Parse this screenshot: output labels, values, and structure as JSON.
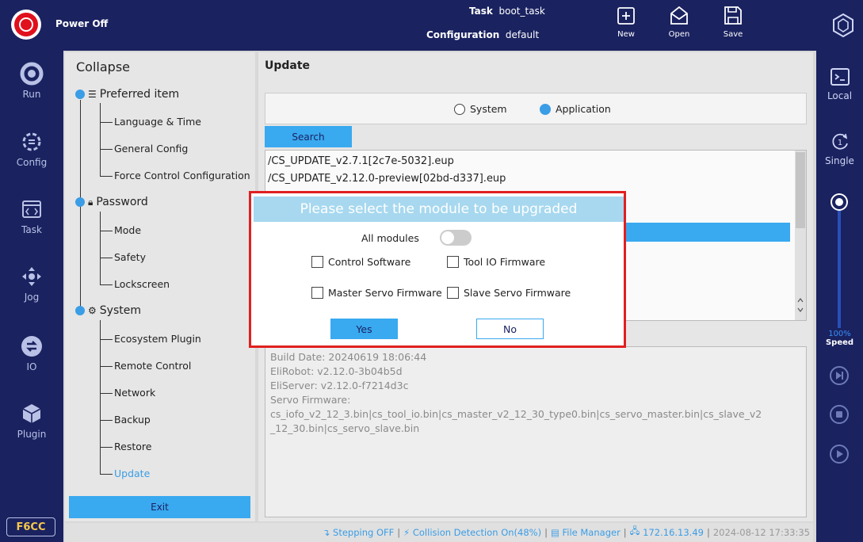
{
  "topbar": {
    "status": "Power Off",
    "task_label": "Task",
    "task_value": "boot_task",
    "config_label": "Configuration",
    "config_value": "default",
    "new_label": "New",
    "open_label": "Open",
    "save_label": "Save"
  },
  "leftnav": {
    "items": [
      {
        "label": "Run",
        "icon": "run-icon"
      },
      {
        "label": "Config",
        "icon": "config-icon"
      },
      {
        "label": "Task",
        "icon": "task-icon"
      },
      {
        "label": "Jog",
        "icon": "jog-icon"
      },
      {
        "label": "IO",
        "icon": "io-icon"
      },
      {
        "label": "Plugin",
        "icon": "plugin-icon"
      }
    ],
    "badge": "F6CC"
  },
  "rightnav": {
    "local_label": "Local",
    "single_label": "Single",
    "single_num": "1",
    "speed_pct": "100%",
    "speed_label": "Speed",
    "speed_value": 1.0
  },
  "settings": {
    "title": "Collapse",
    "groups": [
      {
        "label": "Preferred item",
        "icon": "list-icon",
        "items": [
          "Language & Time",
          "General Config",
          "Force Control Configuration"
        ]
      },
      {
        "label": "Password",
        "icon": "lock-icon",
        "items": [
          "Mode",
          "Safety",
          "Lockscreen"
        ]
      },
      {
        "label": "System",
        "icon": "gear-icon",
        "items": [
          "Ecosystem Plugin",
          "Remote Control",
          "Network",
          "Backup",
          "Restore",
          "Update"
        ]
      }
    ],
    "exit_label": "Exit"
  },
  "update": {
    "title": "Update",
    "radio_system": "System",
    "radio_application": "Application",
    "search_label": "Search",
    "files": [
      "/CS_UPDATE_v2.7.1[2c7e-5032].eup",
      "/CS_UPDATE_v2.12.0-preview[02bd-d337].eup"
    ],
    "info_lines": [
      "Build Date: 20240619 18:06:44",
      "EliRobot: v2.12.0-3b04b5d",
      "EliServer: v2.12.0-f7214d3c",
      "Servo Firmware:",
      "cs_iofo_v2_12_3.bin|cs_tool_io.bin|cs_master_v2_12_30_type0.bin|cs_servo_master.bin|cs_slave_v2",
      "_12_30.bin|cs_servo_slave.bin"
    ]
  },
  "dialog": {
    "title": "Please select the module to be upgraded",
    "all_modules": "All modules",
    "control_software": "Control Software",
    "tool_io": "Tool IO Firmware",
    "master_servo": "Master Servo Firmware",
    "slave_servo": "Slave Servo Firmware",
    "yes": "Yes",
    "no": "No"
  },
  "statusbar": {
    "stepping": "Stepping OFF",
    "collision": "Collision Detection On(48%)",
    "file_manager": "File Manager",
    "ip": "172.16.13.49",
    "datetime": "2024-08-12 17:33:35"
  }
}
